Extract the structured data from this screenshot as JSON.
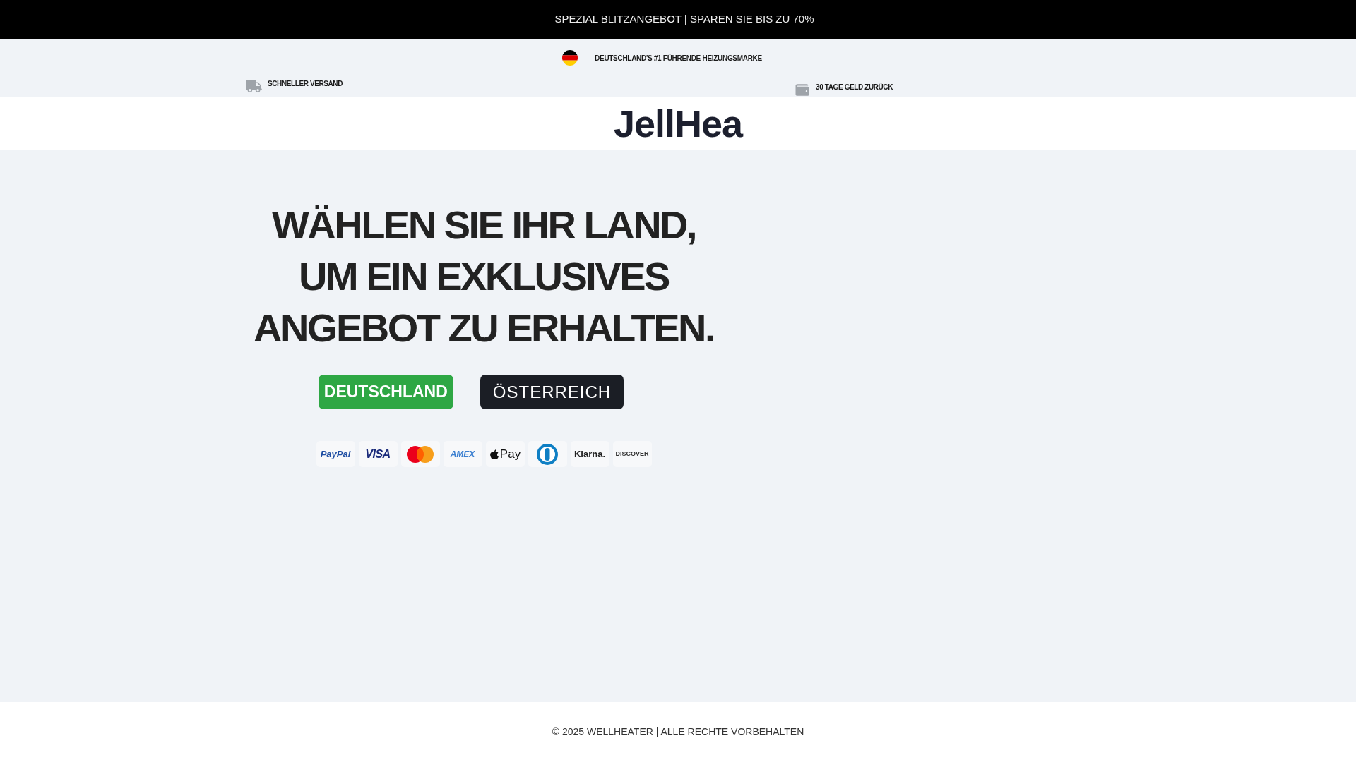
{
  "promo_bar": {
    "text": "SPEZIAL BLITZANGEBOT | SPAREN SIE BIS ZU 70%"
  },
  "info_bar": {
    "headline": "DEUTSCHLAND'S #1 FÜHRENDE HEIZUNGSMARKE",
    "features": [
      {
        "kind": "truck",
        "text": "SCHNELLER VERSAND"
      },
      {
        "kind": "wallet",
        "text": "30 TAGE GELD ZURÜCK"
      }
    ]
  },
  "header": {
    "logo": "JellHea"
  },
  "hero": {
    "heading": "WÄHLEN SIE IHR LAND, UM EIN EXKLUSIVES ANGEBOT ZU ERHALTEN.",
    "buttons": [
      {
        "label": "DEUTSCHLAND",
        "kind": "primary"
      },
      {
        "label": "ÖSTERREICH",
        "kind": "dark"
      }
    ],
    "payment_methods": [
      {
        "kind": "paypal",
        "label": "PayPal"
      },
      {
        "kind": "visa",
        "label": "VISA"
      },
      {
        "kind": "mastercard"
      },
      {
        "kind": "amex",
        "label": "AMEX"
      },
      {
        "kind": "applepay",
        "label": "Pay"
      },
      {
        "kind": "diners"
      },
      {
        "kind": "klarna",
        "label": "Klarna."
      },
      {
        "kind": "discover",
        "label": "DISCOVER"
      }
    ]
  },
  "footer": {
    "text": "© 2025 WELLHEATER | ALLE RECHTE VORBEHALTEN"
  }
}
